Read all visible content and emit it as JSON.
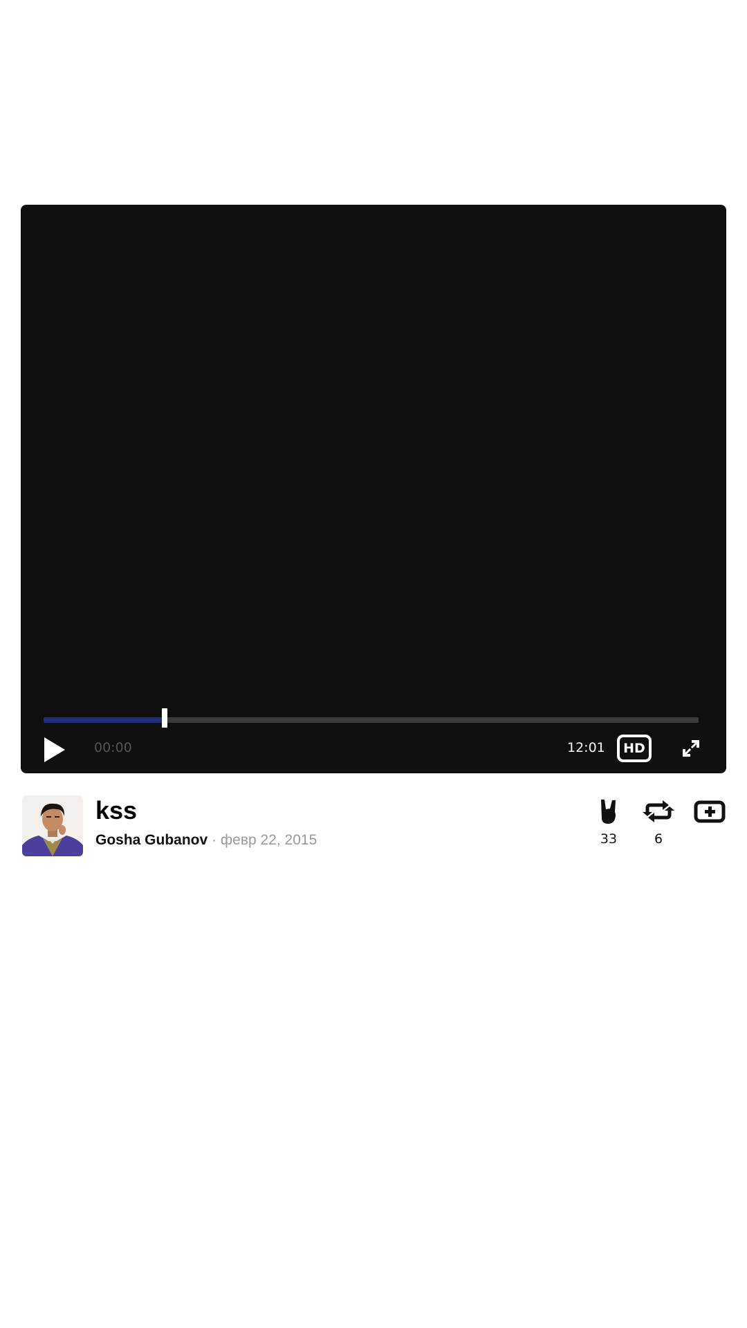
{
  "player": {
    "current_time": "00:00",
    "total_time": "12:01",
    "progress": 0.185,
    "hd_label": "HD",
    "colors": {
      "background": "#0f0f0f",
      "seek_fill": "#1d2f7e",
      "seek_track": "#3b3b3b"
    }
  },
  "post": {
    "title": "kss",
    "author": "Gosha Gubanov",
    "separator": "·",
    "date": "февр 22, 2015"
  },
  "actions": {
    "rock": {
      "icon": "rock-hand-icon",
      "count": "33"
    },
    "repost": {
      "icon": "repost-icon",
      "count": "6"
    },
    "add": {
      "icon": "add-to-playlist-icon"
    }
  }
}
